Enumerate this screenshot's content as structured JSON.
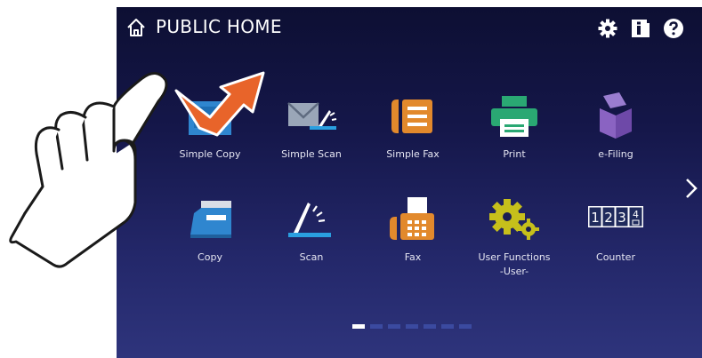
{
  "header": {
    "title": "PUBLIC HOME"
  },
  "icons": {
    "home": "home-icon",
    "settings": "gear-icon",
    "info": "info-icon",
    "help": "help-icon",
    "next": "chevron-right-icon"
  },
  "tiles": [
    {
      "label": "Simple Copy"
    },
    {
      "label": "Simple Scan"
    },
    {
      "label": "Simple Fax"
    },
    {
      "label": "Print"
    },
    {
      "label": "e-Filing"
    },
    {
      "label": "Copy"
    },
    {
      "label": "Scan"
    },
    {
      "label": "Fax"
    },
    {
      "label": "User Functions",
      "label2": "-User-"
    },
    {
      "label": "Counter"
    }
  ],
  "counter_digits": [
    "1",
    "2",
    "3",
    "4"
  ],
  "pagination": {
    "pages": 7,
    "current": 1
  },
  "colors": {
    "accent_blue": "#2f86cf",
    "fax_orange": "#e2892c",
    "print_green": "#2aa873",
    "efiling_purple": "#7f5bb5",
    "gear_yellow": "#c6bf1b",
    "arrow_orange": "#e8642a"
  }
}
